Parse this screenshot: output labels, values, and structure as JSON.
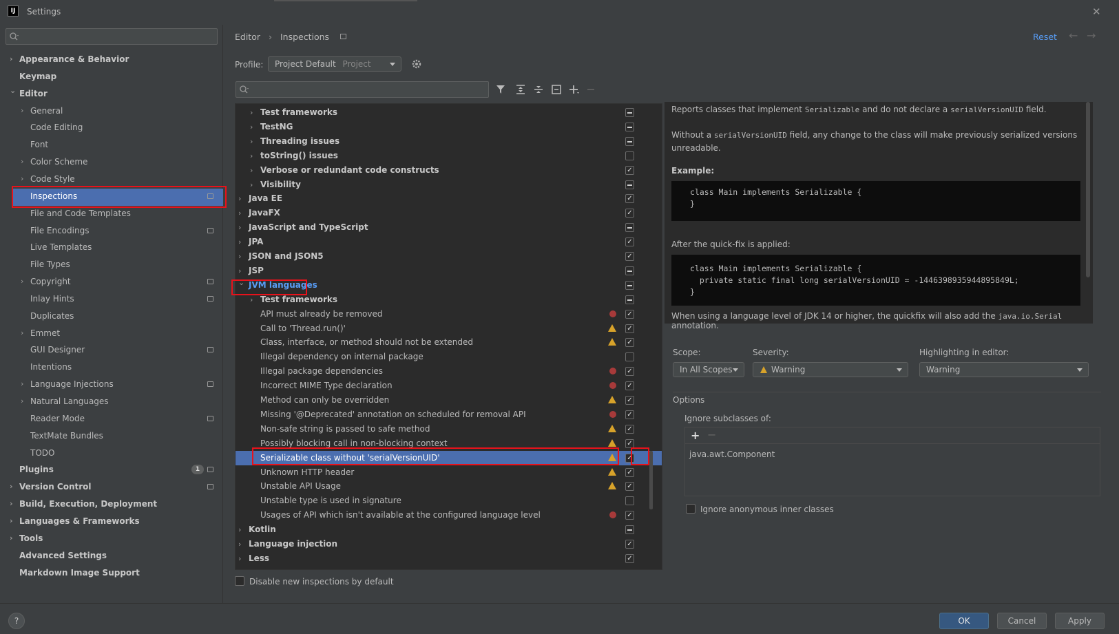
{
  "window": {
    "title": "Settings"
  },
  "sidebar": {
    "items": [
      {
        "label": "Appearance & Behavior"
      },
      {
        "label": "Keymap"
      },
      {
        "label": "Editor"
      },
      {
        "label": "General"
      },
      {
        "label": "Code Editing"
      },
      {
        "label": "Font"
      },
      {
        "label": "Color Scheme"
      },
      {
        "label": "Code Style"
      },
      {
        "label": "Inspections"
      },
      {
        "label": "File and Code Templates"
      },
      {
        "label": "File Encodings"
      },
      {
        "label": "Live Templates"
      },
      {
        "label": "File Types"
      },
      {
        "label": "Copyright"
      },
      {
        "label": "Inlay Hints"
      },
      {
        "label": "Duplicates"
      },
      {
        "label": "Emmet"
      },
      {
        "label": "GUI Designer"
      },
      {
        "label": "Intentions"
      },
      {
        "label": "Language Injections"
      },
      {
        "label": "Natural Languages"
      },
      {
        "label": "Reader Mode"
      },
      {
        "label": "TextMate Bundles"
      },
      {
        "label": "TODO"
      },
      {
        "label": "Plugins",
        "badge": "1"
      },
      {
        "label": "Version Control"
      },
      {
        "label": "Build, Execution, Deployment"
      },
      {
        "label": "Languages & Frameworks"
      },
      {
        "label": "Tools"
      },
      {
        "label": "Advanced Settings"
      },
      {
        "label": "Markdown Image Support"
      }
    ]
  },
  "header": {
    "breadcrumb": [
      "Editor",
      "Inspections"
    ],
    "reset": "Reset"
  },
  "profile": {
    "label": "Profile:",
    "value": "Project Default",
    "scope": "Project"
  },
  "tree": [
    {
      "label": "Test frameworks"
    },
    {
      "label": "TestNG"
    },
    {
      "label": "Threading issues"
    },
    {
      "label": "toString() issues"
    },
    {
      "label": "Verbose or redundant code constructs"
    },
    {
      "label": "Visibility"
    },
    {
      "label": "Java EE"
    },
    {
      "label": "JavaFX"
    },
    {
      "label": "JavaScript and TypeScript"
    },
    {
      "label": "JPA"
    },
    {
      "label": "JSON and JSON5"
    },
    {
      "label": "JSP"
    },
    {
      "label": "JVM languages"
    },
    {
      "label": "Test frameworks"
    },
    {
      "label": "API must already be removed"
    },
    {
      "label": "Call to 'Thread.run()'"
    },
    {
      "label": "Class, interface, or method should not be extended"
    },
    {
      "label": "Illegal dependency on internal package"
    },
    {
      "label": "Illegal package dependencies"
    },
    {
      "label": "Incorrect MIME Type declaration"
    },
    {
      "label": "Method can only be overridden"
    },
    {
      "label": "Missing '@Deprecated' annotation on scheduled for removal API"
    },
    {
      "label": "Non-safe string is passed to safe method"
    },
    {
      "label": "Possibly blocking call in non-blocking context"
    },
    {
      "label": "Serializable class without 'serialVersionUID'"
    },
    {
      "label": "Unknown HTTP header"
    },
    {
      "label": "Unstable API Usage"
    },
    {
      "label": "Unstable type is used in signature"
    },
    {
      "label": "Usages of API which isn't available at the configured language level"
    },
    {
      "label": "Kotlin"
    },
    {
      "label": "Language injection"
    },
    {
      "label": "Less"
    }
  ],
  "tree_footer": {
    "disable_new": "Disable new inspections by default"
  },
  "description": {
    "p1_a": "Reports classes that implement ",
    "p1_code1": "Serializable",
    "p1_b": " and do not declare a ",
    "p1_code2": "serialVersionUID",
    "p1_c": " field.",
    "p2_a": "Without a ",
    "p2_code": "serialVersionUID",
    "p2_b": " field, any change to the class will make previously serialized versions unreadable.",
    "example_label": "Example:",
    "code1_line1": "class Main implements Serializable {",
    "code1_line2": "}",
    "after_label": "After the quick-fix is applied:",
    "code2_line1": "class Main implements Serializable {",
    "code2_line2": "  private static final long serialVersionUID = -1446398935944895849L;",
    "code2_line3": "}",
    "p3_a": "When using a language level of JDK 14 or higher, the quickfix will also add the ",
    "p3_code": "java.io.Serial",
    "p3_b": " annotation."
  },
  "settings": {
    "scope_label": "Scope:",
    "scope_value": "In All Scopes",
    "severity_label": "Severity:",
    "severity_value": "Warning",
    "highlight_label": "Highlighting in editor:",
    "highlight_value": "Warning",
    "options_label": "Options",
    "ignore_subclasses_label": "Ignore subclasses of:",
    "ignore_subclasses_item": "java.awt.Component",
    "ignore_anon": "Ignore anonymous inner classes"
  },
  "footer": {
    "ok": "OK",
    "cancel": "Cancel",
    "apply": "Apply",
    "help": "?"
  },
  "colors": {
    "selection": "#4b6eaf",
    "highlight_box": "#e8121b",
    "link": "#589df6",
    "warning": "#d7a22a",
    "error": "#a73a3a"
  }
}
